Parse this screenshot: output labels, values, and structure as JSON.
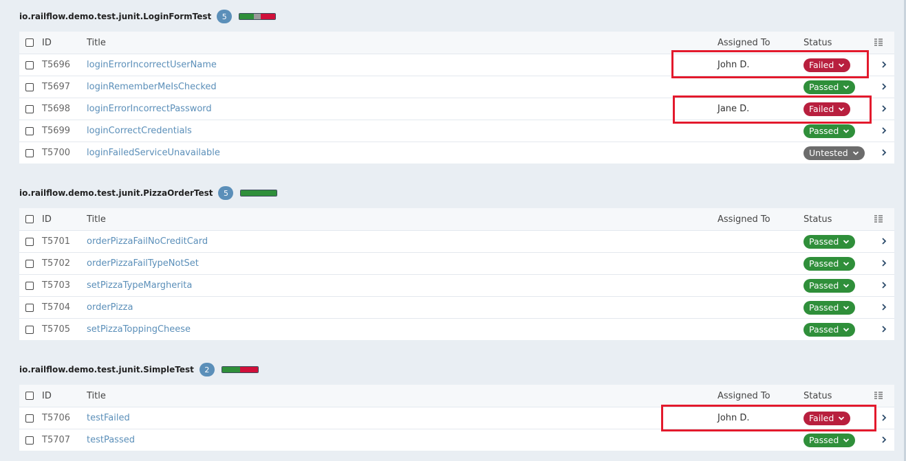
{
  "columns": {
    "id": "ID",
    "title": "Title",
    "assigned_to": "Assigned To",
    "status": "Status"
  },
  "colors": {
    "failed": "#b81f3e",
    "passed": "#2f8f3a",
    "untested": "#6c6c6c",
    "badge": "#5b8fb9",
    "highlight": "#e3192c"
  },
  "sections": [
    {
      "title": "io.railflow.demo.test.junit.LoginFormTest",
      "count": "5",
      "progress": {
        "passed": 0.4,
        "untested": 0.2,
        "failed": 0.4
      },
      "rows": [
        {
          "id": "T5696",
          "title": "loginErrorIncorrectUserName",
          "assigned": "John D.",
          "status": "Failed"
        },
        {
          "id": "T5697",
          "title": "loginRememberMeIsChecked",
          "assigned": "",
          "status": "Passed"
        },
        {
          "id": "T5698",
          "title": "loginErrorIncorrectPassword",
          "assigned": "Jane D.",
          "status": "Failed"
        },
        {
          "id": "T5699",
          "title": "loginCorrectCredentials",
          "assigned": "",
          "status": "Passed"
        },
        {
          "id": "T5700",
          "title": "loginFailedServiceUnavailable",
          "assigned": "",
          "status": "Untested"
        }
      ]
    },
    {
      "title": "io.railflow.demo.test.junit.PizzaOrderTest",
      "count": "5",
      "progress": {
        "passed": 1.0,
        "untested": 0,
        "failed": 0
      },
      "rows": [
        {
          "id": "T5701",
          "title": "orderPizzaFailNoCreditCard",
          "assigned": "",
          "status": "Passed"
        },
        {
          "id": "T5702",
          "title": "orderPizzaFailTypeNotSet",
          "assigned": "",
          "status": "Passed"
        },
        {
          "id": "T5703",
          "title": "setPizzaTypeMargherita",
          "assigned": "",
          "status": "Passed"
        },
        {
          "id": "T5704",
          "title": "orderPizza",
          "assigned": "",
          "status": "Passed"
        },
        {
          "id": "T5705",
          "title": "setPizzaToppingCheese",
          "assigned": "",
          "status": "Passed"
        }
      ]
    },
    {
      "title": "io.railflow.demo.test.junit.SimpleTest",
      "count": "2",
      "progress": {
        "passed": 0.5,
        "untested": 0,
        "failed": 0.5
      },
      "rows": [
        {
          "id": "T5706",
          "title": "testFailed",
          "assigned": "John D.",
          "status": "Failed"
        },
        {
          "id": "T5707",
          "title": "testPassed",
          "assigned": "",
          "status": "Passed"
        }
      ]
    }
  ]
}
